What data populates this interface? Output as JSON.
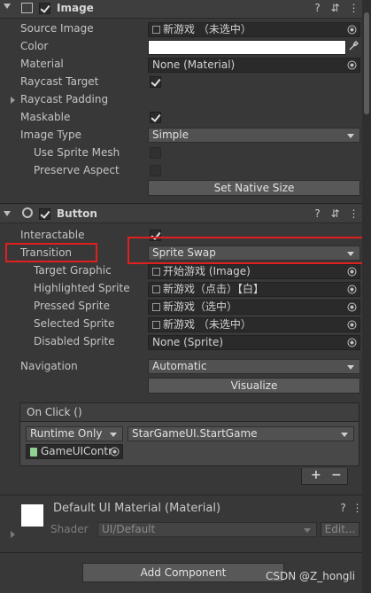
{
  "image": {
    "title": "Image",
    "rows": [
      {
        "label": "Source Image",
        "value": "新游戏 （未选中）"
      },
      {
        "label": "Color",
        "value": ""
      },
      {
        "label": "Material",
        "value": "None (Material)"
      },
      {
        "label": "Raycast Target"
      },
      {
        "label": "Raycast Padding"
      },
      {
        "label": "Maskable"
      },
      {
        "label": "Image Type",
        "value": "Simple"
      },
      {
        "label": "Use Sprite Mesh"
      },
      {
        "label": "Preserve Aspect"
      }
    ],
    "native_size_button": "Set Native Size"
  },
  "button": {
    "title": "Button",
    "interactable_label": "Interactable",
    "transition_label": "Transition",
    "transition_value": "Sprite Swap",
    "target_graphic_label": "Target Graphic",
    "target_graphic_value": "开始游戏 (Image)",
    "highlighted_label": "Highlighted Sprite",
    "highlighted_value": "新游戏（点击）【白】",
    "pressed_label": "Pressed Sprite",
    "pressed_value": "新游戏（选中）",
    "selected_label": "Selected Sprite",
    "selected_value": "新游戏 （未选中）",
    "disabled_label": "Disabled Sprite",
    "disabled_value": "None (Sprite)",
    "navigation_label": "Navigation",
    "navigation_value": "Automatic",
    "visualize_button": "Visualize",
    "onclick_title": "On Click ()",
    "runtime_value": "Runtime Only",
    "function_value": "StarGameUI.StartGame",
    "object_value": "GameUIContr",
    "plus": "+",
    "minus": "−"
  },
  "material": {
    "title": "Default UI Material (Material)",
    "shader_label": "Shader",
    "shader_value": "UI/Default",
    "edit_button": "Edit..."
  },
  "add_component": "Add Component",
  "watermark": "CSDN @Z_hongli",
  "colors": {
    "highlight_box": "#e0201e",
    "panel_bg": "#383838"
  }
}
